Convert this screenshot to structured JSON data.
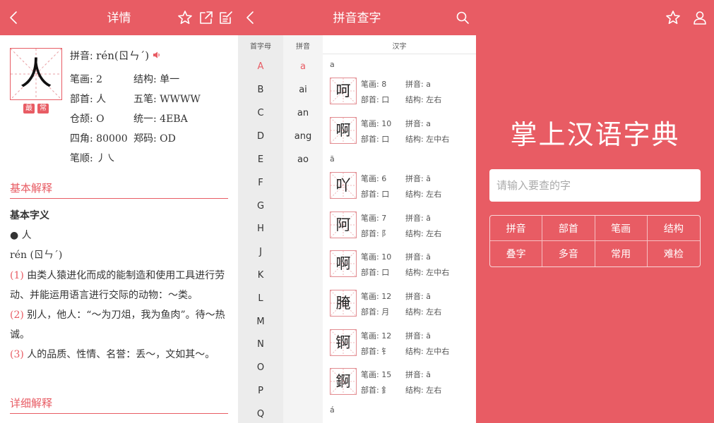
{
  "colors": {
    "accent": "#e85c64"
  },
  "detail": {
    "title": "详情",
    "icons": [
      "back-icon",
      "star-icon",
      "share-icon",
      "edit-note-icon"
    ],
    "char": "人",
    "tags": [
      "最",
      "常"
    ],
    "pinyin_label": "拼音:",
    "pinyin_value": "rén(ㄖㄣˊ)",
    "fields": [
      {
        "label": "笔画:",
        "value": "2"
      },
      {
        "label": "结构:",
        "value": "单一"
      },
      {
        "label": "部首:",
        "value": "人"
      },
      {
        "label": "五笔:",
        "value": "WWWW"
      },
      {
        "label": "仓颉:",
        "value": "O"
      },
      {
        "label": "统一:",
        "value": "4EBA"
      },
      {
        "label": "四角:",
        "value": "80000"
      },
      {
        "label": "郑码:",
        "value": "OD"
      },
      {
        "label": "笔顺:",
        "value": "丿㇏"
      }
    ],
    "basic_title": "基本解释",
    "basic_subtitle": "基本字义",
    "bullet": "● 人",
    "reading": "rén (ㄖㄣˊ)",
    "defs": [
      {
        "num": "(1)",
        "text": " 由类人猿进化而成的能制造和使用工具进行劳动、并能运用语言进行交际的动物：～类。"
      },
      {
        "num": "(2)",
        "text": " 别人，他人：“～为刀俎，我为鱼肉”。待～热诚。"
      },
      {
        "num": "(3)",
        "text": " 人的品质、性情、名誉：丢～，文如其～。"
      }
    ],
    "detail_title": "详细解释"
  },
  "pinyin_lookup": {
    "title": "拼音查字",
    "icons": [
      "back-icon",
      "search-icon"
    ],
    "headers": {
      "initial": "首字母",
      "pinyin": "拼音",
      "hanzi": "汉字"
    },
    "letters": [
      "A",
      "B",
      "C",
      "D",
      "E",
      "F",
      "G",
      "H",
      "J",
      "K",
      "L",
      "M",
      "N",
      "O",
      "P",
      "Q"
    ],
    "pinyins": [
      "a",
      "ai",
      "an",
      "ang",
      "ao"
    ],
    "groups": [
      {
        "label": "a",
        "chars": [
          {
            "char": "呵",
            "strokes": "笔画: 8",
            "pinyin": "拼音: a",
            "radical": "部首: 口",
            "structure": "结构: 左右"
          },
          {
            "char": "啊",
            "strokes": "笔画: 10",
            "pinyin": "拼音: a",
            "radical": "部首: 口",
            "structure": "结构: 左中右"
          }
        ]
      },
      {
        "label": "ā",
        "chars": [
          {
            "char": "吖",
            "strokes": "笔画: 6",
            "pinyin": "拼音: ā",
            "radical": "部首: 口",
            "structure": "结构: 左右"
          },
          {
            "char": "阿",
            "strokes": "笔画: 7",
            "pinyin": "拼音: ā",
            "radical": "部首: 阝",
            "structure": "结构: 左右"
          },
          {
            "char": "啊",
            "strokes": "笔画: 10",
            "pinyin": "拼音: ā",
            "radical": "部首: 口",
            "structure": "结构: 左中右"
          },
          {
            "char": "腌",
            "strokes": "笔画: 12",
            "pinyin": "拼音: ā",
            "radical": "部首: 月",
            "structure": "结构: 左右"
          },
          {
            "char": "锕",
            "strokes": "笔画: 12",
            "pinyin": "拼音: ā",
            "radical": "部首: 钅",
            "structure": "结构: 左中右"
          },
          {
            "char": "錒",
            "strokes": "笔画: 15",
            "pinyin": "拼音: ā",
            "radical": "部首: 釒",
            "structure": "结构: 左右"
          }
        ]
      },
      {
        "label": "á",
        "chars": []
      }
    ]
  },
  "home": {
    "icons": [
      "star-icon",
      "user-icon"
    ],
    "app_title": "掌上汉语字典",
    "search_placeholder": "请输入要查的字",
    "grid": [
      "拼音",
      "部首",
      "笔画",
      "结构",
      "叠字",
      "多音",
      "常用",
      "难检"
    ]
  }
}
